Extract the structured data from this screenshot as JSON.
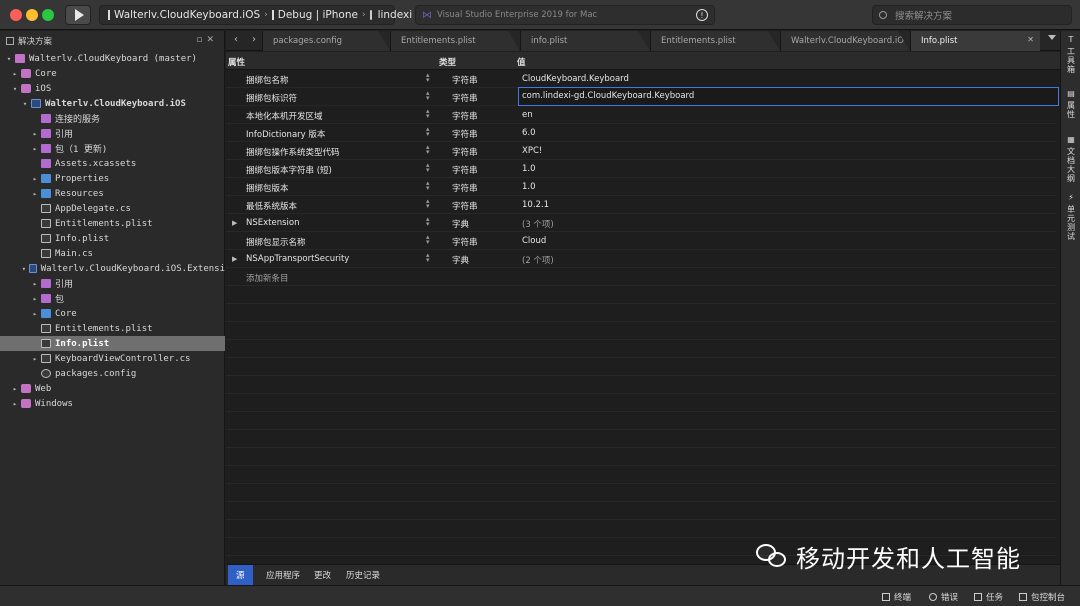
{
  "titlebar": {
    "run_target": {
      "project": "Walterlv.CloudKeyboard.iOS",
      "config": "Debug | iPhone",
      "device": "lindexi"
    },
    "status_text": "Visual Studio Enterprise 2019 for Mac",
    "search_placeholder": "搜索解决方案",
    "colors": {
      "close": "#fe5f57",
      "minimize": "#febc2e",
      "zoom": "#28c840"
    }
  },
  "sidebar": {
    "title": "解决方案",
    "tree": [
      {
        "label": "Walterlv.CloudKeyboard (master)",
        "icon": "solution-icon",
        "arrow": "▾"
      },
      {
        "label": "Core",
        "icon": "project-icon",
        "arrow": "▸"
      },
      {
        "label": "iOS",
        "icon": "project-icon",
        "arrow": "▾"
      },
      {
        "label": "Walterlv.CloudKeyboard.iOS",
        "icon": "ios-project-icon",
        "arrow": "▾",
        "bold": true
      },
      {
        "label": "连接的服务",
        "icon": "connected-services-icon",
        "arrow": ""
      },
      {
        "label": "引用",
        "icon": "references-icon",
        "arrow": "▸"
      },
      {
        "label": "包（1 更新)",
        "icon": "packages-icon",
        "arrow": "▸"
      },
      {
        "label": "Assets.xcassets",
        "icon": "assets-icon",
        "arrow": ""
      },
      {
        "label": "Properties",
        "icon": "folder-icon",
        "arrow": "▸"
      },
      {
        "label": "Resources",
        "icon": "folder-icon",
        "arrow": "▸"
      },
      {
        "label": "AppDelegate.cs",
        "icon": "file-icon",
        "arrow": ""
      },
      {
        "label": "Entitlements.plist",
        "icon": "file-icon",
        "arrow": ""
      },
      {
        "label": "Info.plist",
        "icon": "file-icon",
        "arrow": ""
      },
      {
        "label": "Main.cs",
        "icon": "file-icon",
        "arrow": ""
      },
      {
        "label": "Walterlv.CloudKeyboard.iOS.Extensi",
        "icon": "ios-project-icon",
        "arrow": "▾"
      },
      {
        "label": "引用",
        "icon": "references-icon",
        "arrow": "▸"
      },
      {
        "label": "包",
        "icon": "packages-icon",
        "arrow": "▸"
      },
      {
        "label": "Core",
        "icon": "folder-icon",
        "arrow": "▸"
      },
      {
        "label": "Entitlements.plist",
        "icon": "file-icon",
        "arrow": ""
      },
      {
        "label": "Info.plist",
        "icon": "file-icon",
        "arrow": "",
        "selected": true
      },
      {
        "label": "KeyboardViewController.cs",
        "icon": "file-icon",
        "arrow": "▸"
      },
      {
        "label": "packages.config",
        "icon": "config-icon",
        "arrow": ""
      },
      {
        "label": "Web",
        "icon": "project-icon",
        "arrow": "▸"
      },
      {
        "label": "Windows",
        "icon": "project-icon",
        "arrow": "▸"
      }
    ]
  },
  "tabs": [
    "packages.config",
    "Entitlements.plist",
    "info.plist",
    "Entitlements.plist",
    "Walterlv.CloudKeyboard.iO",
    "Info.plist"
  ],
  "active_tab": 5,
  "plist": {
    "headers": {
      "property": "属性",
      "type": "类型",
      "value": "值"
    },
    "rows": [
      {
        "key": "捆绑包名称",
        "type": "字符串",
        "value": "CloudKeyboard.Keyboard",
        "expand": ""
      },
      {
        "key": "捆绑包标识符",
        "type": "字符串",
        "value": "com.lindexi-gd.CloudKeyboard.Keyboard",
        "expand": "",
        "editing": true
      },
      {
        "key": "本地化本机开发区域",
        "type": "字符串",
        "value": "en",
        "expand": ""
      },
      {
        "key": "InfoDictionary 版本",
        "type": "字符串",
        "value": "6.0",
        "expand": ""
      },
      {
        "key": "捆绑包操作系统类型代码",
        "type": "字符串",
        "value": "XPC!",
        "expand": ""
      },
      {
        "key": "捆绑包版本字符串 (短)",
        "type": "字符串",
        "value": "1.0",
        "expand": ""
      },
      {
        "key": "捆绑包版本",
        "type": "字符串",
        "value": "1.0",
        "expand": ""
      },
      {
        "key": "最低系统版本",
        "type": "字符串",
        "value": "10.2.1",
        "expand": ""
      },
      {
        "key": "NSExtension",
        "type": "字典",
        "value": "(3 个项)",
        "expand": "▶",
        "muted": true
      },
      {
        "key": "捆绑包显示名称",
        "type": "字符串",
        "value": "Cloud",
        "expand": ""
      },
      {
        "key": "NSAppTransportSecurity",
        "type": "字典",
        "value": "(2 个项)",
        "expand": "▶",
        "muted": true
      }
    ],
    "add_entry": "添加新条目"
  },
  "bottom_tabs": [
    "源",
    "应用程序",
    "更改",
    "历史记录"
  ],
  "right_dock": [
    "工具箱",
    "属性",
    "文档大纲",
    "单元测试"
  ],
  "statusbar": [
    "终端",
    "错误",
    "任务",
    "包控制台"
  ],
  "watermark": "移动开发和人工智能"
}
